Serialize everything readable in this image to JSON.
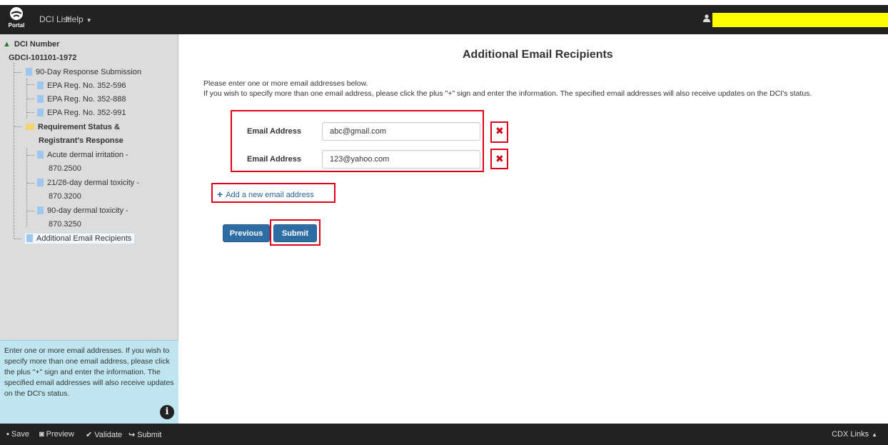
{
  "header": {
    "logo_text": "Portal",
    "nav": [
      {
        "label": "DCI List"
      },
      {
        "label": "Help"
      }
    ],
    "highlight_color": "#ffff00"
  },
  "sidebar": {
    "dci_number_label": "DCI Number",
    "dci_number": "GDCI-101101-1972",
    "items": [
      {
        "label": "90-Day Response Submission"
      },
      {
        "label": "EPA Reg. No. 352-596"
      },
      {
        "label": "EPA Reg. No. 352-888"
      },
      {
        "label": "EPA Reg. No. 352-991"
      },
      {
        "label": "Requirement Status &"
      },
      {
        "label": "Registrant's Response"
      },
      {
        "label": "Acute dermal irritation -"
      },
      {
        "label": "870.2500"
      },
      {
        "label": "21/28-day dermal toxicity -"
      },
      {
        "label": "870.3200"
      },
      {
        "label": "90-day dermal toxicity -"
      },
      {
        "label": "870.3250"
      },
      {
        "label": "Additional Email Recipients"
      }
    ],
    "help_text": "Enter one or more email addresses. If you wish to specify more than one email address, please click the plus \"+\" sign and enter the information. The specified email addresses will also receive updates on the DCI's status."
  },
  "main": {
    "title": "Additional Email Recipients",
    "intro_line1": "Please enter one or more email addresses below.",
    "intro_line2": "If you wish to specify more than one email address, please click the plus \"+\" sign and enter the information. The specified email addresses will also receive updates on the DCI's status.",
    "emails": [
      {
        "label": "Email Address",
        "value": "abc@gmail.com"
      },
      {
        "label": "Email Address",
        "value": "123@yahoo.com"
      }
    ],
    "add_link": "Add a new email address",
    "previous_button": "Previous",
    "submit_button": "Submit",
    "annotation_color": "#e0001b"
  },
  "footer": {
    "save": "Save",
    "preview": "Preview",
    "validate": "Validate",
    "submit": "Submit",
    "cdx_links": "CDX Links"
  }
}
